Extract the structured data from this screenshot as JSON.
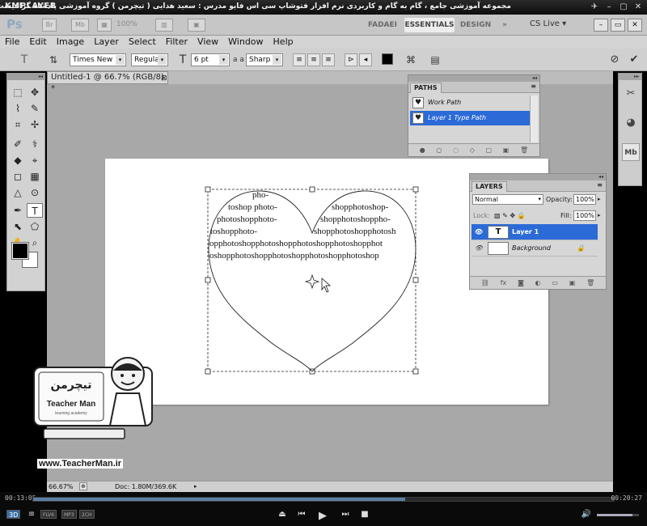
{
  "player": {
    "logo": "KMPLAYER",
    "caption": "مجموعه آموزشی جامع ، گام به گام و کاربردی نرم افزار فتوشاپ سی اس فایو  مدرس : سعید هدایی ( تیچرمن ) گروه آموزشی پادشاه گرافیست ها",
    "time_elapsed": "00:13:05",
    "time_total": "00:20:27",
    "progress": 0.64,
    "volume": 0.85,
    "badges": [
      "3D",
      "FLV6",
      "MP3",
      "2CH"
    ],
    "controls": {
      "playlist": "≡",
      "eject": "⏏",
      "prev": "⏮",
      "play": "▶",
      "next": "⏭",
      "stop": "■",
      "volume": "🔊"
    }
  },
  "appbar": {
    "logo": "Ps",
    "zoom": "100%",
    "workspaces": [
      "FADAEI",
      "ESSENTIALS",
      "DESIGN"
    ],
    "more": "»",
    "cs_live": "CS Live ▾",
    "icons": {
      "br": "Br",
      "mb": "Mb"
    },
    "window_controls": [
      "–",
      "▭",
      "✕"
    ]
  },
  "menu": [
    "File",
    "Edit",
    "Image",
    "Layer",
    "Select",
    "Filter",
    "View",
    "Window",
    "Help"
  ],
  "options": {
    "tool_glyph": "T",
    "font_family": "Times New ...",
    "font_style": "Regular",
    "font_size": "6 pt",
    "aa_label": "a a",
    "antialias": "Sharp",
    "dropdown_arrow": "▾",
    "cancel": "⊘",
    "commit": "✔"
  },
  "tools": {
    "collapse": "◂◂",
    "glyphs": [
      "⬚",
      "✥",
      "⌇",
      "✎",
      "⌗",
      "✢",
      "✐",
      "⚕",
      "◆",
      "⌖",
      "◻",
      "▦",
      "△",
      "⊙",
      "✒",
      "T",
      "⬉",
      "⬠",
      "✋",
      "⌕"
    ]
  },
  "document": {
    "tab_title": "Untitled-1 @ 66.7% (RGB/8) *",
    "tab_close": "⊠",
    "zoom_status": "66.67%",
    "doc_info": "Doc: 1.80M/369.6K",
    "heart_text": [
      "pho-",
      "toshop photo-",
      "photoshopphoto-",
      "toshopphoto-",
      "shopphotoshop-",
      "shopphotoshoppho-",
      "shopphotoshopphotosh",
      "opphotoshopphotoshopphotoshopphotoshopphot",
      "oshopphotoshopphotoshopphotoshopphotoshop"
    ]
  },
  "paths_panel": {
    "title": "PATHS",
    "collapse": "◂◂",
    "menu": "≡",
    "rows": [
      {
        "name": "Work Path",
        "selected": false
      },
      {
        "name": "Layer 1 Type Path",
        "selected": true
      }
    ],
    "footer": [
      "●",
      "○",
      "◌",
      "◇",
      "▢",
      "▣",
      "🗑"
    ]
  },
  "layers_panel": {
    "title": "LAYERS",
    "collapse": "◂◂",
    "menu": "≡",
    "blend_mode": "Normal",
    "opacity_label": "Opacity:",
    "opacity": "100%",
    "lock_label": "Lock:",
    "fill_label": "Fill:",
    "fill": "100%",
    "lock_icons": "▧ ✎ ✥ 🔒",
    "rows": [
      {
        "name": "Layer 1",
        "thumb": "T",
        "selected": true,
        "locked": false
      },
      {
        "name": "Background",
        "thumb": "",
        "selected": false,
        "locked": true
      }
    ],
    "footer": [
      "⛓",
      "fx",
      "◙",
      "◐",
      "▭",
      "▣",
      "🗑"
    ]
  },
  "dock": {
    "collapse": "▸▸",
    "icons": [
      "✂",
      "◕",
      "Mb"
    ]
  },
  "watermark": {
    "brand": "Teacher Man",
    "brand_fa": "تیچرمن",
    "tagline": "learning academy",
    "url": "www.TeacherMan.ir"
  },
  "colors": {
    "accent": "#2b6ad7",
    "panel": "#d6d6d6",
    "canvas_bg": "#a8a8a8"
  }
}
